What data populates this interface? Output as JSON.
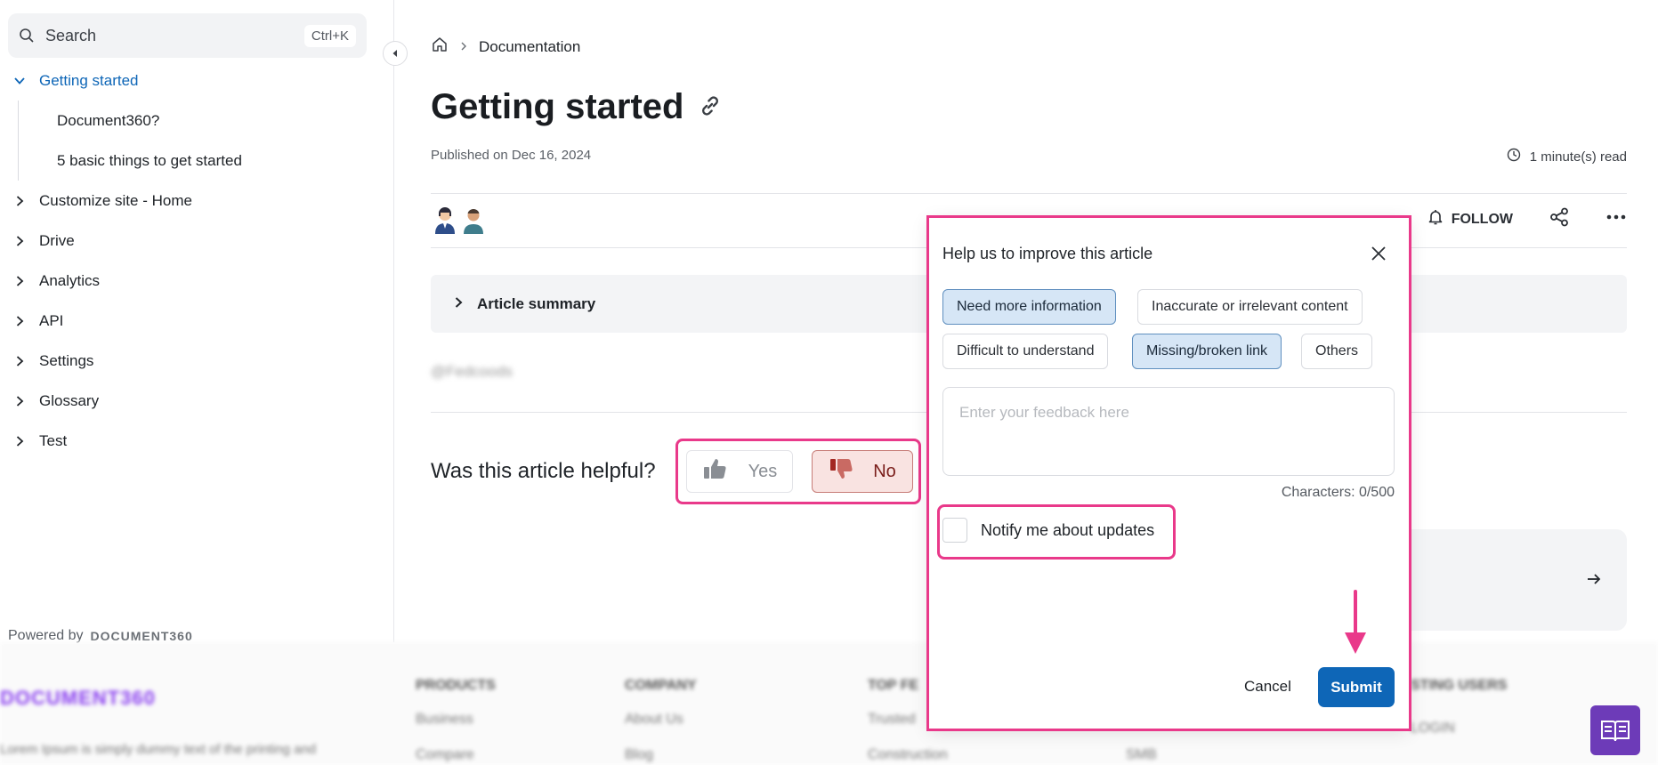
{
  "sidebar": {
    "search": {
      "label": "Search",
      "shortcut": "Ctrl+K"
    },
    "items": [
      {
        "label": "Getting started",
        "expanded": true,
        "active": true,
        "children": [
          {
            "label": "Document360?"
          },
          {
            "label": "5 basic things to get started"
          }
        ]
      },
      {
        "label": "Customize site - Home"
      },
      {
        "label": "Drive"
      },
      {
        "label": "Analytics"
      },
      {
        "label": "API"
      },
      {
        "label": "Settings"
      },
      {
        "label": "Glossary"
      },
      {
        "label": "Test"
      }
    ],
    "powered_by": "Powered by",
    "powered_brand": "DOCUMENT360"
  },
  "breadcrumb": {
    "home_icon": "home-icon",
    "current": "Documentation"
  },
  "article": {
    "title": "Getting started",
    "published": "Published on Dec 16, 2024",
    "read_time": "1 minute(s) read",
    "follow_label": "FOLLOW",
    "summary_label": "Article summary",
    "blurred_text": "@Fedcoods"
  },
  "feedback": {
    "question": "Was this article helpful?",
    "yes_label": "Yes",
    "no_label": "No"
  },
  "modal": {
    "title": "Help us to improve this article",
    "chips": [
      {
        "label": "Need more information",
        "selected": true
      },
      {
        "label": "Inaccurate or irrelevant content",
        "selected": false
      },
      {
        "label": "Difficult to understand",
        "selected": false
      },
      {
        "label": "Missing/broken link",
        "selected": true
      },
      {
        "label": "Others",
        "selected": false
      }
    ],
    "textarea_placeholder": "Enter your feedback here",
    "textarea_value": "",
    "char_count": "Characters: 0/500",
    "notify_label": "Notify me about updates",
    "notify_checked": false,
    "cancel_label": "Cancel",
    "submit_label": "Submit"
  },
  "footer": {
    "logo": "DOCUMENT360",
    "description": "Lorem Ipsum is simply dummy text of the printing and",
    "columns": [
      "PRODUCTS",
      "COMPANY",
      "TOP FE",
      "STING USERS"
    ],
    "links": [
      "Business",
      "About Us",
      "Trusted",
      "Compare",
      "Blog",
      "Construction",
      "SMB",
      "LOGIN"
    ]
  },
  "colors": {
    "accent": "#0e66b7",
    "highlight": "#e9398a",
    "selected_chip": "#d6e6f6",
    "fab": "#6d3bb8"
  }
}
